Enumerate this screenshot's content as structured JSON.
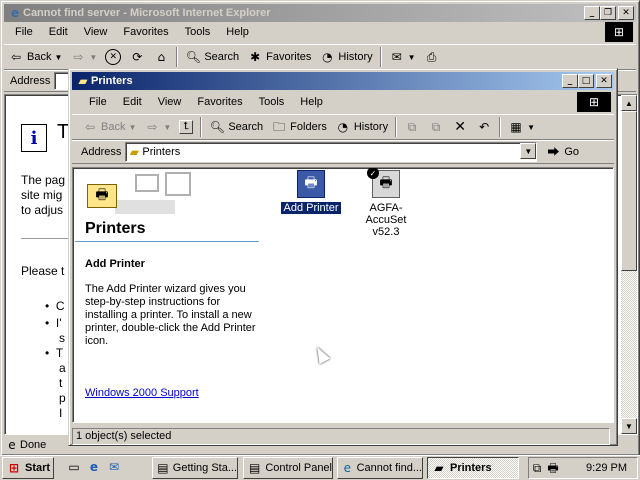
{
  "ie": {
    "title": "Cannot find server - Microsoft Internet Explorer",
    "menu": [
      "File",
      "Edit",
      "View",
      "Favorites",
      "Tools",
      "Help"
    ],
    "toolbar": {
      "back": "Back",
      "search": "Search",
      "favorites": "Favorites",
      "history": "History"
    },
    "address_label": "Address",
    "page": {
      "heading_fragment": "T",
      "para_fragments": [
        "The pag",
        "site mig",
        "to adjus"
      ],
      "please": "Please t",
      "bullets": [
        "C",
        "I'",
        "s",
        "T",
        "a",
        "t",
        "p",
        "I"
      ]
    },
    "status": "Done"
  },
  "printers": {
    "title": "Printers",
    "menu": [
      "File",
      "Edit",
      "View",
      "Favorites",
      "Tools",
      "Help"
    ],
    "toolbar": {
      "back": "Back",
      "search": "Search",
      "folders": "Folders",
      "history": "History"
    },
    "address_label": "Address",
    "address_value": "Printers",
    "go": "Go",
    "panel": {
      "title": "Printers",
      "selected_heading": "Add Printer",
      "description": "The Add Printer wizard gives you step-by-step instructions for installing a printer. To install a new printer, double-click the Add Printer icon.",
      "support_link": "Windows 2000 Support"
    },
    "items": [
      {
        "label": "Add Printer",
        "icon": "add-printer-icon",
        "selected": true
      },
      {
        "label": "AGFA-AccuSet v52.3",
        "icon": "printer-icon",
        "selected": false
      }
    ],
    "status": "1 object(s) selected"
  },
  "taskbar": {
    "start": "Start",
    "buttons": [
      "Getting Sta...",
      "Control Panel",
      "Cannot find...",
      "Printers"
    ],
    "clock": "9:29 PM"
  },
  "colors": {
    "title_active": "#0a246a",
    "title_inactive": "#808080",
    "desktop_gray": "#d4d0c8",
    "selection": "#0a246a"
  }
}
